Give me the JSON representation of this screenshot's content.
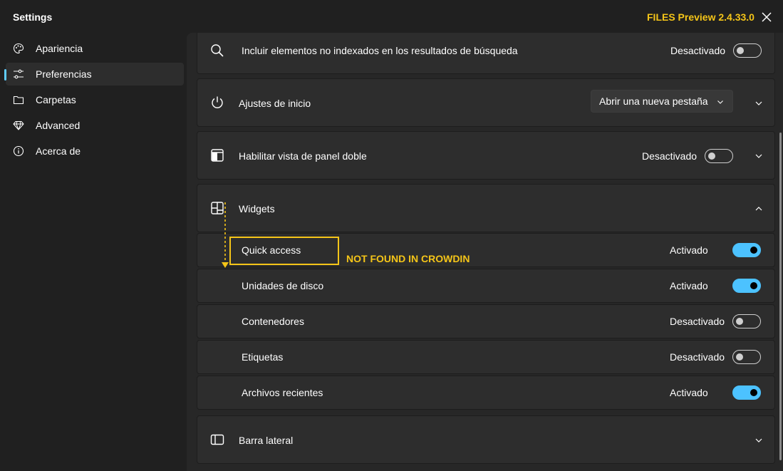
{
  "window": {
    "title": "Settings",
    "version_annotation": "FILES Preview 2.4.33.0"
  },
  "sidebar": {
    "items": [
      {
        "label": "Apariencia",
        "icon": "palette-icon",
        "selected": false
      },
      {
        "label": "Preferencias",
        "icon": "sliders-icon",
        "selected": true
      },
      {
        "label": "Carpetas",
        "icon": "folder-icon",
        "selected": false
      },
      {
        "label": "Advanced",
        "icon": "gem-icon",
        "selected": false
      },
      {
        "label": "Acerca de",
        "icon": "info-icon",
        "selected": false
      }
    ]
  },
  "settings": {
    "search_indexing": {
      "label": "Incluir elementos no indexados en los resultados de búsqueda",
      "state": "Desactivado",
      "on": false,
      "icon": "search-icon"
    },
    "startup": {
      "label": "Ajustes de inicio",
      "value": "Abrir una nueva pestaña",
      "icon": "power-icon"
    },
    "dual_pane": {
      "label": "Habilitar vista de panel doble",
      "state": "Desactivado",
      "on": false,
      "icon": "dual-pane-icon"
    },
    "widgets": {
      "label": "Widgets",
      "icon": "widgets-icon",
      "expanded": true,
      "items": [
        {
          "label": "Quick access",
          "state": "Activado",
          "on": true
        },
        {
          "label": "Unidades de disco",
          "state": "Activado",
          "on": true
        },
        {
          "label": "Contenedores",
          "state": "Desactivado",
          "on": false
        },
        {
          "label": "Etiquetas",
          "state": "Desactivado",
          "on": false
        },
        {
          "label": "Archivos recientes",
          "state": "Activado",
          "on": true
        }
      ]
    },
    "sidebar_section": {
      "label": "Barra lateral",
      "icon": "sidebar-icon"
    }
  },
  "annotation": {
    "note": "NOT FOUND IN CROWDIN"
  },
  "colors": {
    "accent": "#4cc2ff",
    "annotation": "#f5c518",
    "background": "#202020",
    "card": "#2d2d2d"
  }
}
